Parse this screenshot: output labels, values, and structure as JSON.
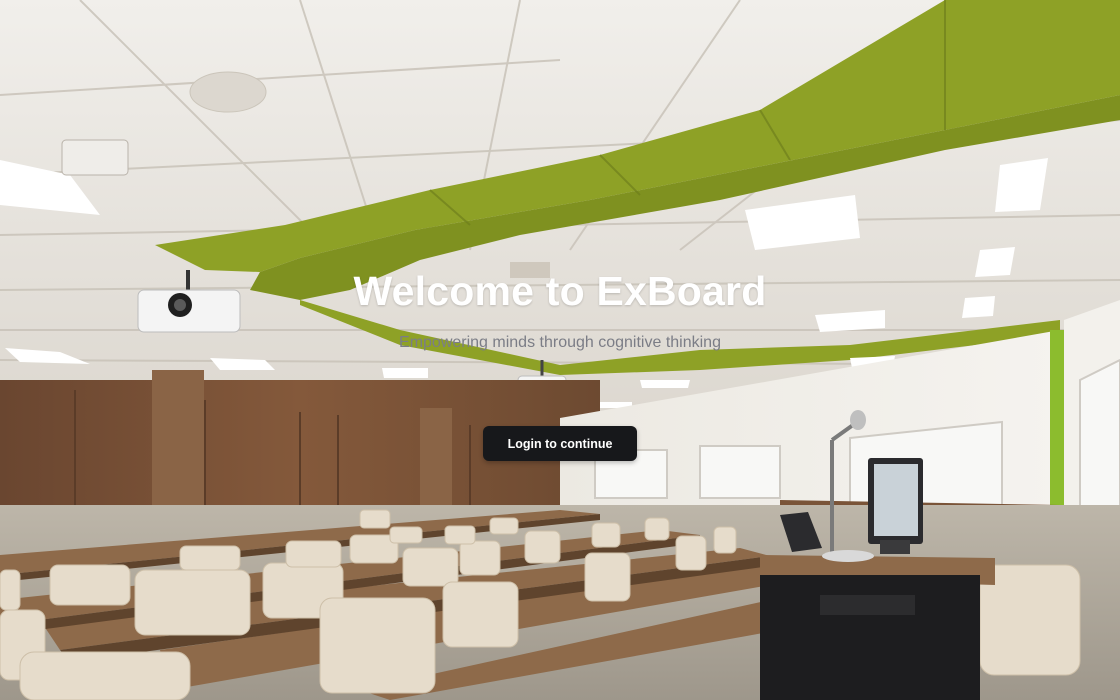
{
  "hero": {
    "title": "Welcome to ExBoard",
    "subtitle": "Empowering minds through cognitive thinking",
    "login_label": "Login to continue"
  },
  "background": {
    "description_icon": "lecture-hall-photo",
    "accent_color": "#8ea126",
    "ceiling_color": "#ece9e3",
    "wall_wood_color": "#7a5438",
    "chair_color": "#e6dccb",
    "desk_color": "#8e6a4a"
  },
  "button": {
    "bg": "#17181b",
    "text_color": "#ffffff"
  }
}
